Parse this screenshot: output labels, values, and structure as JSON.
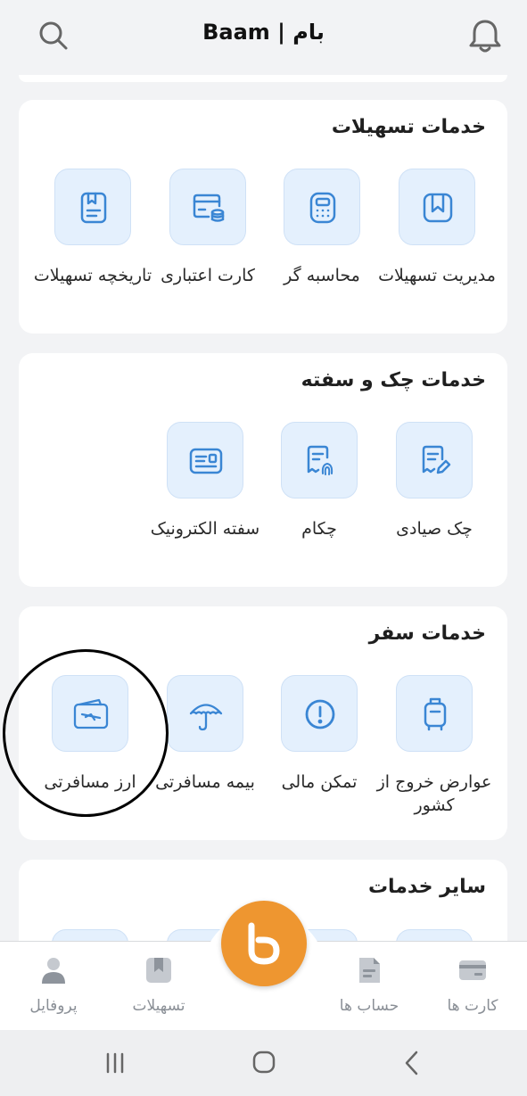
{
  "app": {
    "title": "Baam | بام"
  },
  "sections": [
    {
      "title": "خدمات تسهیلات",
      "items": [
        {
          "label": "مدیریت تسهیلات",
          "icon": "bookmark-icon"
        },
        {
          "label": "محاسبه گر",
          "icon": "calculator-icon"
        },
        {
          "label": "کارت اعتباری",
          "icon": "credit-card-icon"
        },
        {
          "label": "تاریخچه تسهیلات",
          "icon": "history-document-icon"
        }
      ]
    },
    {
      "title": "خدمات چک و سفته",
      "items": [
        {
          "label": "چک صیادی",
          "icon": "check-edit-icon"
        },
        {
          "label": "چکام",
          "icon": "fingerprint-check-icon"
        },
        {
          "label": "سفته الکترونیک",
          "icon": "promissory-note-icon"
        }
      ]
    },
    {
      "title": "خدمات سفر",
      "items": [
        {
          "label": "عوارض خروج از کشور",
          "icon": "suitcase-icon"
        },
        {
          "label": "تمکن مالی",
          "icon": "alert-circle-icon"
        },
        {
          "label": "بیمه مسافرتی",
          "icon": "umbrella-icon"
        },
        {
          "label": "ارز مسافرتی",
          "icon": "travel-currency-icon"
        }
      ]
    },
    {
      "title": "سایر خدمات",
      "items": []
    }
  ],
  "bottom_nav": {
    "items": [
      {
        "label": "کارت ها",
        "icon": "cards-icon"
      },
      {
        "label": "حساب ها",
        "icon": "accounts-icon"
      },
      {
        "label": "تسهیلات",
        "icon": "facilities-icon"
      },
      {
        "label": "پروفایل",
        "icon": "profile-icon"
      }
    ],
    "fab_icon": "baam-logo-icon"
  },
  "colors": {
    "accent": "#ee9630",
    "icon_blue": "#3a86d4",
    "tile_bg": "#e4f0fd"
  }
}
